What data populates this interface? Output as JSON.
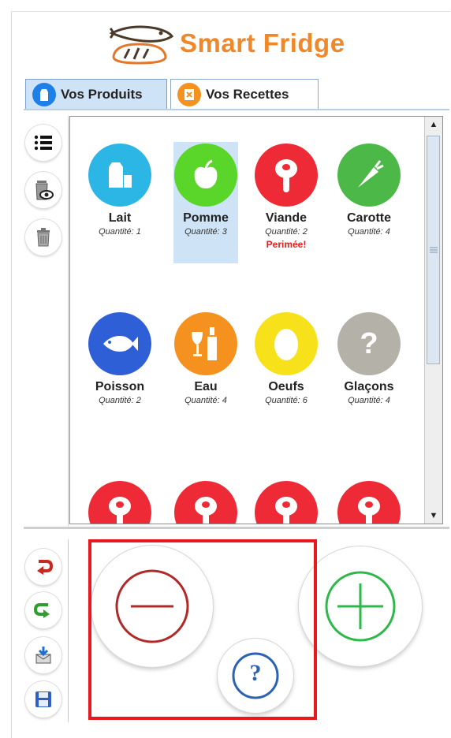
{
  "app": {
    "title": "Smart Fridge"
  },
  "tabs": [
    {
      "label": "Vos Produits",
      "active": true,
      "icon": "milk-carton-icon"
    },
    {
      "label": "Vos Recettes",
      "active": false,
      "icon": "recipe-book-icon"
    }
  ],
  "toolbar": {
    "top": [
      "list-icon",
      "trash-view-icon",
      "trash-icon"
    ],
    "bottom": [
      "undo-icon",
      "redo-icon",
      "import-icon",
      "save-icon"
    ]
  },
  "products": [
    {
      "name": "Lait",
      "qty": "Quantité: 1",
      "color": "#2cb6e6",
      "icon": "milk-icon",
      "selected": false
    },
    {
      "name": "Pomme",
      "qty": "Quantité: 3",
      "color": "#5ad62a",
      "icon": "apple-icon",
      "selected": true
    },
    {
      "name": "Viande",
      "qty": "Quantité: 2",
      "color": "#ee2a36",
      "icon": "meat-icon",
      "selected": false,
      "status": "Perimée!"
    },
    {
      "name": "Carotte",
      "qty": "Quantité: 4",
      "color": "#4cb848",
      "icon": "carrot-icon",
      "selected": false
    },
    {
      "name": "Poisson",
      "qty": "Quantité: 2",
      "color": "#2f5fd6",
      "icon": "fish-icon",
      "selected": false
    },
    {
      "name": "Eau",
      "qty": "Quantité: 4",
      "color": "#f5911e",
      "icon": "drinks-icon",
      "selected": false
    },
    {
      "name": "Oeufs",
      "qty": "Quantité: 6",
      "color": "#f7e11a",
      "icon": "egg-icon",
      "selected": false
    },
    {
      "name": "Glaçons",
      "qty": "Quantité: 4",
      "color": "#b3b1a8",
      "icon": "question-icon",
      "selected": false
    },
    {
      "color": "#ee2a36",
      "icon": "meat-icon"
    },
    {
      "color": "#ee2a36",
      "icon": "meat-icon"
    },
    {
      "color": "#ee2a36",
      "icon": "meat-icon"
    },
    {
      "color": "#ee2a36",
      "icon": "meat-icon"
    }
  ],
  "actions": {
    "remove": {
      "icon": "minus-circle-icon",
      "color": "#b02a2a"
    },
    "help": {
      "icon": "help-icon",
      "label": "?",
      "color": "#2a62b4"
    },
    "add": {
      "icon": "plus-circle-icon",
      "color": "#2fb84a"
    }
  },
  "colors": {
    "brand": "#f0882a",
    "tab_active": "#cfe3f7",
    "highlight": "#e8191e"
  }
}
